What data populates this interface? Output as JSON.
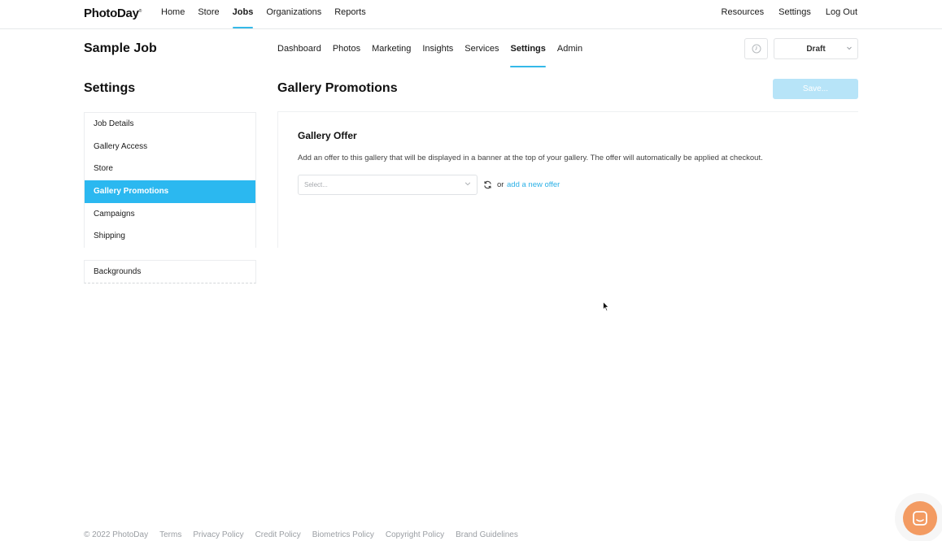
{
  "brand": {
    "logo_text": "PhotoDay",
    "logo_mark": "®",
    "accent_color": "#35b9e8"
  },
  "topnav": {
    "left": [
      {
        "label": "Home",
        "active": false
      },
      {
        "label": "Store",
        "active": false
      },
      {
        "label": "Jobs",
        "active": true
      },
      {
        "label": "Organizations",
        "active": false
      },
      {
        "label": "Reports",
        "active": false
      }
    ],
    "right": [
      {
        "label": "Resources"
      },
      {
        "label": "Settings"
      },
      {
        "label": "Log Out"
      }
    ]
  },
  "job": {
    "title": "Sample Job",
    "tabs": [
      {
        "label": "Dashboard",
        "active": false
      },
      {
        "label": "Photos",
        "active": false
      },
      {
        "label": "Marketing",
        "active": false
      },
      {
        "label": "Insights",
        "active": false
      },
      {
        "label": "Services",
        "active": false
      },
      {
        "label": "Settings",
        "active": true
      },
      {
        "label": "Admin",
        "active": false
      }
    ],
    "history_icon": "clock-icon",
    "status": {
      "value": "Draft",
      "icon": "chevron-down-icon"
    }
  },
  "sidebar": {
    "title": "Settings",
    "items": [
      {
        "label": "Job Details",
        "active": false
      },
      {
        "label": "Gallery Access",
        "active": false
      },
      {
        "label": "Store",
        "active": false
      },
      {
        "label": "Gallery Promotions",
        "active": true
      },
      {
        "label": "Campaigns",
        "active": false
      },
      {
        "label": "Shipping",
        "active": false
      }
    ],
    "secondary_items": [
      {
        "label": "Backgrounds",
        "active": false
      }
    ]
  },
  "main": {
    "title": "Gallery Promotions",
    "save_label": "Save...",
    "card": {
      "title": "Gallery Offer",
      "description": "Add an offer to this gallery that will be displayed in a banner at the top of your gallery. The offer will automatically be applied at checkout.",
      "select_placeholder": "Select...",
      "or_text": "or",
      "add_link": "add a new offer"
    }
  },
  "footer": {
    "copyright": "© 2022 PhotoDay",
    "links": [
      "Terms",
      "Privacy Policy",
      "Credit Policy",
      "Biometrics Policy",
      "Copyright Policy",
      "Brand Guidelines"
    ]
  },
  "chat": {
    "icon": "chat-icon",
    "color": "#f39b62"
  }
}
